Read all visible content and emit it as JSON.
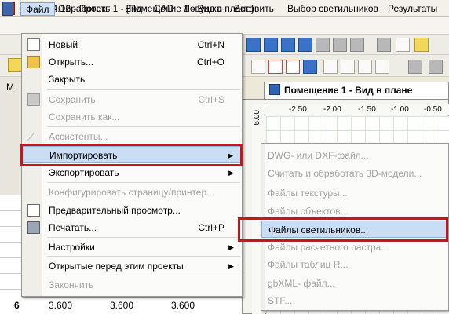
{
  "window": {
    "title": "DIALux 4.12 - Проект 1 - [Помещение 1 - Вид в плане]"
  },
  "menubar": {
    "items": [
      "Файл",
      "Обработать",
      "Вид",
      "CAD",
      "Ловушка",
      "Вставить",
      "Выбор светильников",
      "Результаты"
    ]
  },
  "file_menu": {
    "items": [
      {
        "label": "Новый",
        "shortcut": "Ctrl+N",
        "enabled": true
      },
      {
        "label": "Открыть...",
        "shortcut": "Ctrl+O",
        "enabled": true
      },
      {
        "label": "Закрыть",
        "shortcut": "",
        "enabled": true
      },
      {
        "label": "Сохранить",
        "shortcut": "Ctrl+S",
        "enabled": false
      },
      {
        "label": "Сохранить как...",
        "shortcut": "",
        "enabled": false
      },
      {
        "label": "Ассистенты...",
        "shortcut": "",
        "enabled": false
      },
      {
        "label": "Импортировать",
        "shortcut": "",
        "enabled": true,
        "submenu": true,
        "highlighted": true
      },
      {
        "label": "Экспортировать",
        "shortcut": "",
        "enabled": true,
        "submenu": true
      },
      {
        "label": "Конфигурировать страницу/принтер...",
        "shortcut": "",
        "enabled": false
      },
      {
        "label": "Предварительный просмотр...",
        "shortcut": "",
        "enabled": true
      },
      {
        "label": "Печатать...",
        "shortcut": "Ctrl+P",
        "enabled": true
      },
      {
        "label": "Настройки",
        "shortcut": "",
        "enabled": true,
        "submenu": true
      },
      {
        "label": "Открытые перед этим проекты",
        "shortcut": "",
        "enabled": true,
        "submenu": true
      },
      {
        "label": "Закончить",
        "shortcut": "",
        "enabled": false
      }
    ]
  },
  "import_submenu": {
    "items": [
      {
        "label": "DWG- или DXF-файл...",
        "enabled": false
      },
      {
        "label": "Считать и обработать 3D-модели...",
        "enabled": false
      },
      {
        "label": "Файлы текстуры...",
        "enabled": false
      },
      {
        "label": "Файлы объектов...",
        "enabled": false
      },
      {
        "label": "Файлы светильников...",
        "enabled": true,
        "highlighted": true
      },
      {
        "label": "Файлы расчетного растра...",
        "enabled": false
      },
      {
        "label": "Файлы таблиц R...",
        "enabled": false
      },
      {
        "label": "gbXML- файл...",
        "enabled": false
      },
      {
        "label": "STF...",
        "enabled": false
      }
    ]
  },
  "view": {
    "tab_label": "Помещение 1 - Вид в плане",
    "ruler_top": [
      "-2.50",
      "-2.00",
      "-1.50",
      "-1.00",
      "-0.50"
    ],
    "ruler_left": "5.00"
  },
  "left_panel": {
    "label": "M"
  },
  "table": {
    "row_label": "6",
    "cells": [
      "3.600",
      "3.600",
      "3.600"
    ]
  },
  "colors": {
    "highlight": "#c9def5",
    "callout_red": "#d0101a",
    "disabled_text": "#a3a3a3"
  }
}
